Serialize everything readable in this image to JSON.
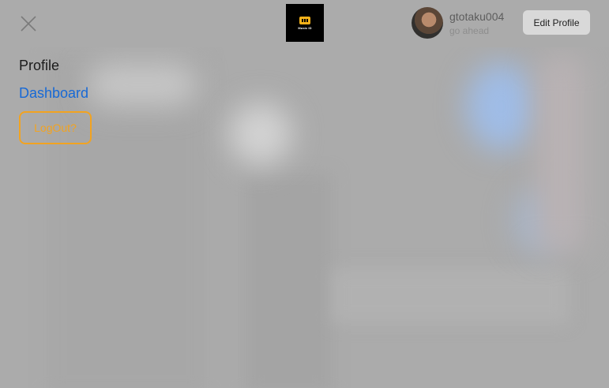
{
  "header": {
    "logo_text": "Music ID",
    "user": {
      "username": "gtotaku004",
      "status": "go ahead"
    },
    "edit_profile_label": "Edit Profile"
  },
  "menu": {
    "profile_label": "Profile",
    "dashboard_label": "Dashboard",
    "logout_label": "LogOut?"
  },
  "colors": {
    "accent_link": "#1769d6",
    "accent_logout": "#f2a320",
    "logo_badge": "#f6b21a"
  },
  "icons": [
    "close-icon",
    "logo-icon",
    "avatar"
  ]
}
